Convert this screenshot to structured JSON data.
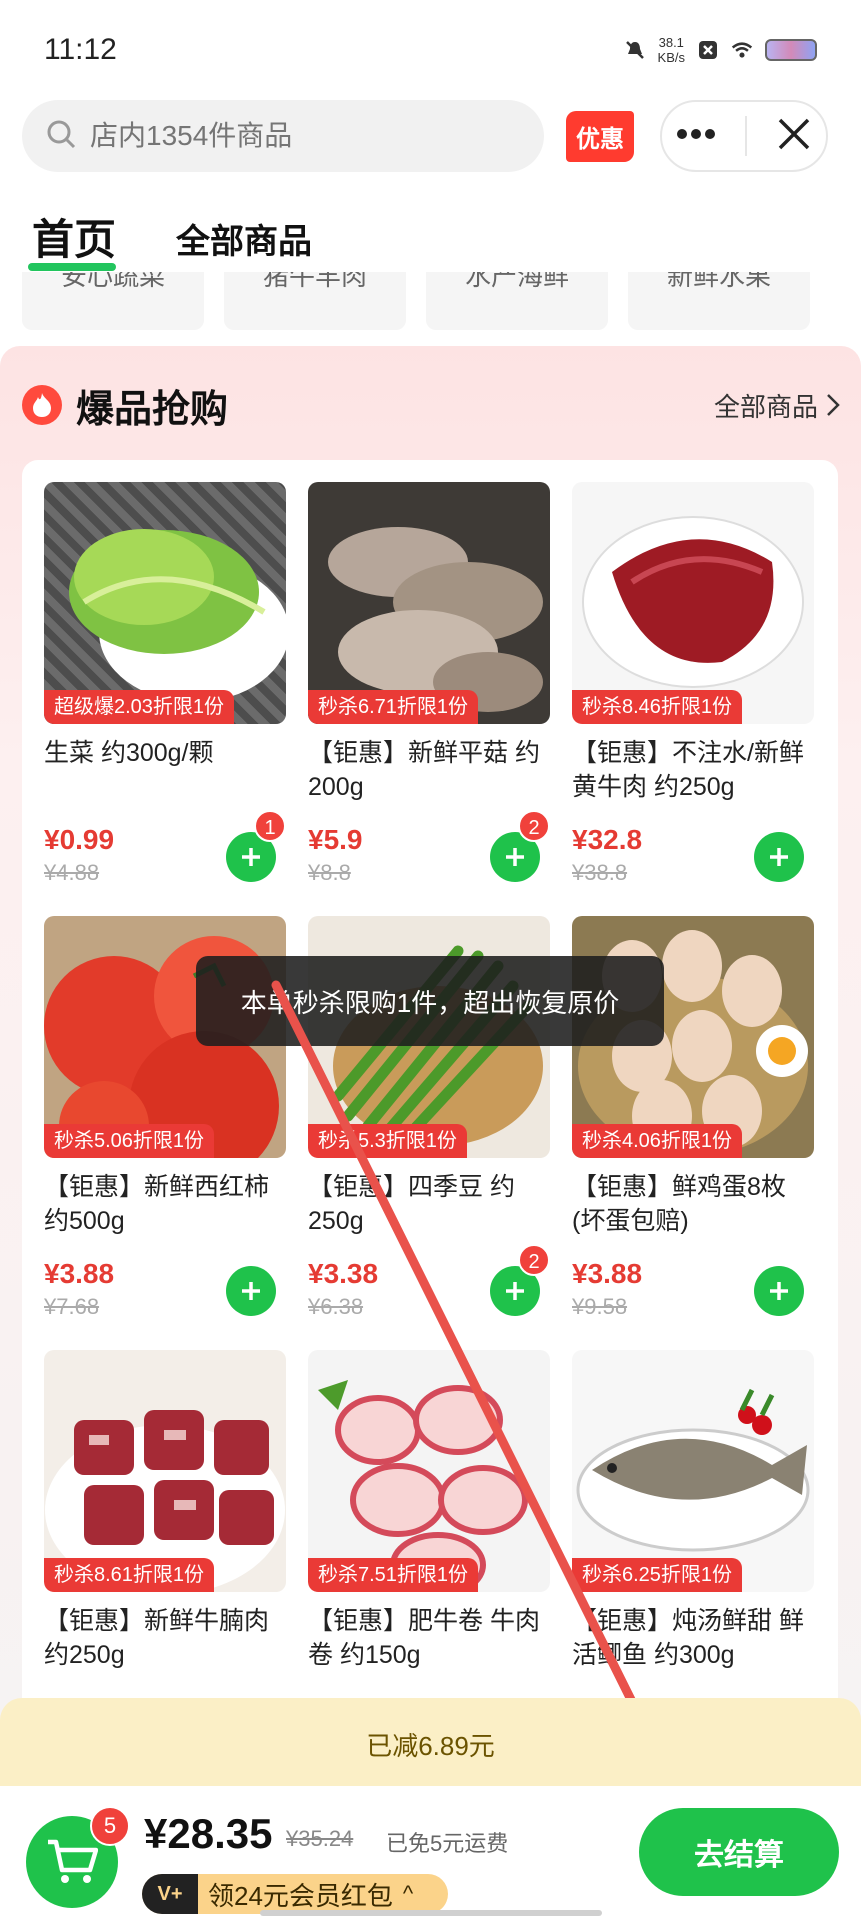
{
  "status": {
    "time": "11:12",
    "speed_value": "38.1",
    "speed_unit": "KB/s"
  },
  "search": {
    "placeholder": "店内1354件商品",
    "promo": "优惠"
  },
  "tabs": [
    "首页",
    "全部商品"
  ],
  "categories": [
    "安心蔬菜",
    "猪牛羊肉",
    "水产海鲜",
    "新鲜水果"
  ],
  "section": {
    "title": "爆品抢购",
    "more": "全部商品"
  },
  "products": [
    {
      "tag": "超级爆2.03折限1份",
      "title": "生菜 约300g/颗",
      "price": "¥0.99",
      "orig": "¥4.88",
      "count": "1",
      "img": "lettuce"
    },
    {
      "tag": "秒杀6.71折限1份",
      "title": "【钜惠】新鲜平菇 约200g",
      "price": "¥5.9",
      "orig": "¥8.8",
      "count": "2",
      "img": "mushroom"
    },
    {
      "tag": "秒杀8.46折限1份",
      "title": "【钜惠】不注水/新鲜黄牛肉 约250g",
      "price": "¥32.8",
      "orig": "¥38.8",
      "count": "",
      "img": "beef"
    },
    {
      "tag": "秒杀5.06折限1份",
      "title": "【钜惠】新鲜西红柿约500g",
      "price": "¥3.88",
      "orig": "¥7.68",
      "count": "",
      "img": "tomato"
    },
    {
      "tag": "秒杀5.3折限1份",
      "title": "【钜惠】四季豆 约250g",
      "price": "¥3.38",
      "orig": "¥6.38",
      "count": "2",
      "img": "beans"
    },
    {
      "tag": "秒杀4.06折限1份",
      "title": "【钜惠】鲜鸡蛋8枚(坏蛋包赔)",
      "price": "¥3.88",
      "orig": "¥9.58",
      "count": "",
      "img": "eggs"
    },
    {
      "tag": "秒杀8.61折限1份",
      "title": "【钜惠】新鲜牛腩肉约250g",
      "price": "",
      "orig": "",
      "count": "",
      "img": "brisket"
    },
    {
      "tag": "秒杀7.51折限1份",
      "title": "【钜惠】肥牛卷 牛肉卷 约150g",
      "price": "",
      "orig": "",
      "count": "",
      "img": "rolls"
    },
    {
      "tag": "秒杀6.25折限1份",
      "title": "【钜惠】炖汤鲜甜 鲜活鲫鱼 约300g",
      "price": "",
      "orig": "",
      "count": "",
      "img": "fish"
    }
  ],
  "toast": "本单秒杀限购1件，超出恢复原价",
  "discount": "已减6.89元",
  "bottom": {
    "cart_count": "5",
    "total": "¥28.35",
    "orig_total": "¥35.24",
    "fee": "已免5元运费",
    "vip_icon": "V+",
    "vip_text": "领24元会员红包",
    "vip_caret": "^",
    "checkout": "去结算"
  },
  "colors": {
    "accent": "#1fc24b",
    "price": "#e53b33",
    "tag": "#ea3a36",
    "annotation_arrow": "#e9524b"
  }
}
